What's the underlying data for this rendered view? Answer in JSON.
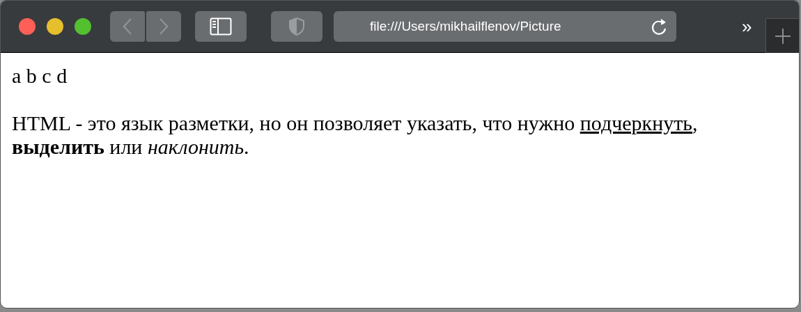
{
  "toolbar": {
    "address": "file:///Users/mikhailflenov/Picture",
    "overflow": "»"
  },
  "page": {
    "line": "a b c d",
    "paragraph": [
      {
        "kind": "plain",
        "text": "HTML - это язык разметки, но он позволяет указать, что нужно "
      },
      {
        "kind": "underline",
        "text": "подчеркнуть"
      },
      {
        "kind": "plain",
        "text": ", "
      },
      {
        "kind": "bold",
        "text": "выделить"
      },
      {
        "kind": "plain",
        "text": " или "
      },
      {
        "kind": "italic",
        "text": "наклонить"
      },
      {
        "kind": "plain",
        "text": "."
      }
    ]
  }
}
